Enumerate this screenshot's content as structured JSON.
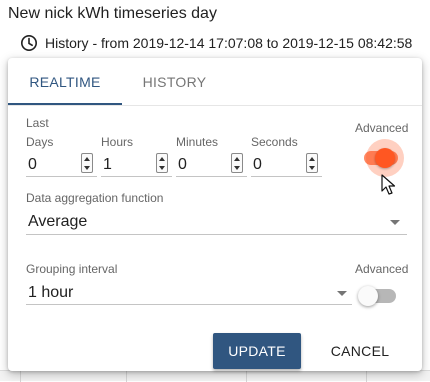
{
  "widget": {
    "title": "New nick kWh timeseries day",
    "timewindow_label": "History - from 2019-12-14 17:07:08 to 2019-12-15 08:42:58"
  },
  "panel": {
    "tabs": [
      {
        "label": "REALTIME",
        "active": true
      },
      {
        "label": "HISTORY",
        "active": false
      }
    ],
    "last_label": "Last",
    "advanced_label": "Advanced",
    "fields": {
      "days": {
        "label": "Days",
        "value": "0"
      },
      "hours": {
        "label": "Hours",
        "value": "1"
      },
      "minutes": {
        "label": "Minutes",
        "value": "0"
      },
      "seconds": {
        "label": "Seconds",
        "value": "0"
      }
    },
    "advanced_realtime_on": true,
    "aggregation": {
      "label": "Data aggregation function",
      "value": "Average"
    },
    "grouping": {
      "label": "Grouping interval",
      "value": "1 hour",
      "advanced_label": "Advanced",
      "advanced_on": false
    },
    "buttons": {
      "update": "UPDATE",
      "cancel": "CANCEL"
    }
  },
  "colors": {
    "primary": "#305680",
    "switch_accent": "#ff5722",
    "switch_off_track": "#b7b7b7"
  },
  "icons": [
    "clock-icon",
    "spinner-up-icon",
    "spinner-down-icon",
    "dropdown-caret-icon",
    "mouse-pointer-icon"
  ]
}
